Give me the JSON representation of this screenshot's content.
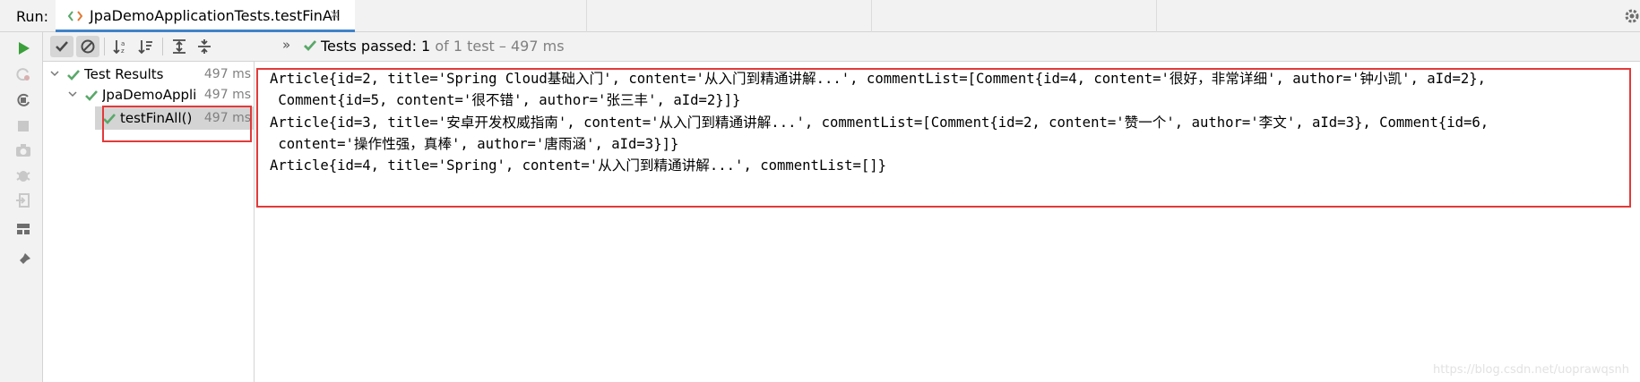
{
  "topbar": {
    "run_label": "Run:",
    "tab_title": "JpaDemoApplicationTests.testFinAll",
    "tab_close": "×"
  },
  "toolbar": {
    "overflow_chevron": "»",
    "status_prefix": "Tests passed: ",
    "passed_count": "1",
    "status_suffix": " of 1 test – 497 ms"
  },
  "tree": {
    "items": [
      {
        "name": "Test Results",
        "time": "497 ms"
      },
      {
        "name": "JpaDemoAppli",
        "time": "497 ms"
      },
      {
        "name": "testFinAll()",
        "time": "497 ms"
      }
    ]
  },
  "console": {
    "lines": [
      "Article{id=2, title='Spring Cloud基础入门', content='从入门到精通讲解...', commentList=[Comment{id=4, content='很好，非常详细', author='钟小凯', aId=2},",
      " Comment{id=5, content='很不错', author='张三丰', aId=2}]}",
      "Article{id=3, title='安卓开发权威指南', content='从入门到精通讲解...', commentList=[Comment{id=2, content='赞一个', author='李文', aId=3}, Comment{id=6,",
      " content='操作性强，真棒', author='唐雨涵', aId=3}]}",
      "Article{id=4, title='Spring', content='从入门到精通讲解...', commentList=[]}"
    ]
  },
  "watermark": "https://blog.csdn.net/uoprawqsnh",
  "colors": {
    "pass_green": "#59a869",
    "run_green": "#3aa03a",
    "highlight_red": "#e23a3a",
    "tab_underline": "#4083c9"
  },
  "icons": [
    "run-icon",
    "rerun-failed-icon",
    "toggle-auto-test-icon",
    "stop-icon",
    "dump-threads-icon",
    "debug-icon",
    "exit-icon",
    "layout-icon",
    "pin-icon",
    "show-passed-icon",
    "show-ignored-icon",
    "sort-alphabetically-icon",
    "sort-by-duration-icon",
    "expand-all-icon",
    "collapse-all-icon",
    "settings-gear-icon"
  ]
}
